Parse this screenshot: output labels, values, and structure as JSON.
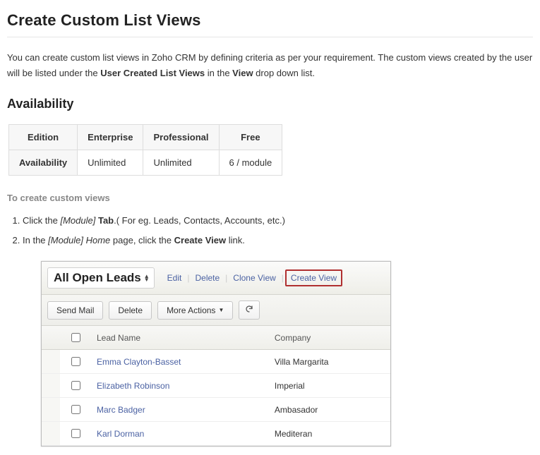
{
  "page_title": "Create Custom List Views",
  "intro_1": "You can create custom list views in Zoho CRM by defining criteria as per your requirement. The custom views created by the user will be listed under the ",
  "intro_bold1": "User Created List Views",
  "intro_2": " in the ",
  "intro_bold2": "View",
  "intro_3": " drop down list.",
  "availability_heading": "Availability",
  "avail_table": {
    "head_edition": "Edition",
    "head_enterprise": "Enterprise",
    "head_professional": "Professional",
    "head_free": "Free",
    "rowhead": "Availability",
    "v_enterprise": "Unlimited",
    "v_professional": "Unlimited",
    "v_free": "6 / module"
  },
  "subhead": "To create custom views",
  "step1_a": "Click the ",
  "step1_em": "[Module]",
  "step1_bold": "Tab",
  "step1_b": ".( For eg. Leads, Contacts, Accounts, etc.)",
  "step2_a": "In the ",
  "step2_em": "[Module] Home",
  "step2_b": " page, click the ",
  "step2_bold": "Create View",
  "step2_c": " link.",
  "mockup": {
    "view_name": "All Open Leads",
    "link_edit": "Edit",
    "link_delete": "Delete",
    "link_clone": "Clone View",
    "link_create": "Create View",
    "btn_sendmail": "Send Mail",
    "btn_delete": "Delete",
    "btn_more": "More Actions",
    "col_leadname": "Lead Name",
    "col_company": "Company",
    "rows": [
      {
        "name": "Emma Clayton-Basset",
        "company": "Villa Margarita"
      },
      {
        "name": "Elizabeth Robinson",
        "company": "Imperial"
      },
      {
        "name": "Marc Badger",
        "company": "Ambasador"
      },
      {
        "name": "Karl Dorman",
        "company": "Mediteran"
      }
    ]
  }
}
